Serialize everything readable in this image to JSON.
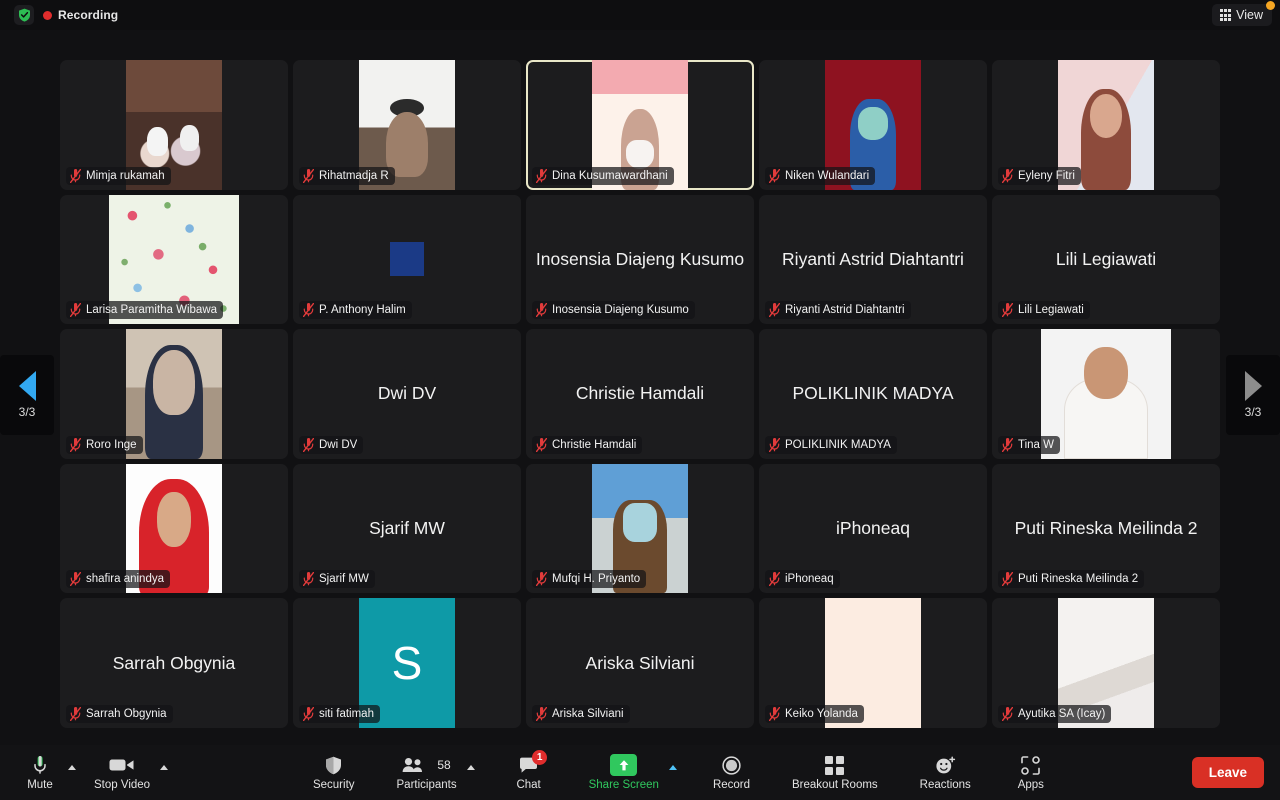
{
  "topbar": {
    "shield_icon": "shield-check-icon",
    "recording_label": "Recording",
    "view_label": "View",
    "view_icon": "grid-icon"
  },
  "gallery": {
    "page_indicator": "3/3",
    "prev_label": "3/3",
    "next_label": "3/3",
    "active_accent": "#e9e7c8",
    "participants": [
      {
        "name": "Mimja rukamah",
        "display": "",
        "muted": true,
        "video": "room",
        "active": false
      },
      {
        "name": "Rihatmadja R",
        "display": "",
        "muted": true,
        "video": "whiteboard",
        "active": false
      },
      {
        "name": "Dina Kusumawardhani",
        "display": "",
        "muted": true,
        "video": "pink-banner",
        "active": true
      },
      {
        "name": "Niken Wulandari",
        "display": "",
        "muted": true,
        "video": "red-banner",
        "active": false
      },
      {
        "name": "Eyleny Fitri",
        "display": "",
        "muted": true,
        "video": "pink-backdrop",
        "active": false
      },
      {
        "name": "Larisa Paramitha Wibawa",
        "display": "",
        "muted": true,
        "video": "floral",
        "active": false
      },
      {
        "name": "P. Anthony Halim",
        "display": "",
        "muted": true,
        "video": "blue-square",
        "active": false
      },
      {
        "name": "Inosensia Diajeng Kusumo",
        "display": "Inosensia Diajeng Kusumo",
        "muted": true,
        "video": "none",
        "active": false
      },
      {
        "name": "Riyanti Astrid Diahtantri",
        "display": "Riyanti Astrid Diahtantri",
        "muted": true,
        "video": "none",
        "active": false
      },
      {
        "name": "Lili Legiawati",
        "display": "Lili Legiawati",
        "muted": true,
        "video": "none",
        "active": false
      },
      {
        "name": "Roro Inge",
        "display": "",
        "muted": true,
        "video": "hijab-room",
        "active": false
      },
      {
        "name": "Dwi DV",
        "display": "Dwi DV",
        "muted": true,
        "video": "none",
        "active": false
      },
      {
        "name": "Christie Hamdali",
        "display": "Christie Hamdali",
        "muted": true,
        "video": "none",
        "active": false
      },
      {
        "name": "POLIKLINIK MADYA",
        "display": "POLIKLINIK MADYA",
        "muted": true,
        "video": "none",
        "active": false
      },
      {
        "name": "Tina W",
        "display": "",
        "muted": true,
        "video": "portrait-white",
        "active": false
      },
      {
        "name": "shafira anindya",
        "display": "",
        "muted": true,
        "video": "red-hijab",
        "active": false
      },
      {
        "name": "Sjarif MW",
        "display": "Sjarif MW",
        "muted": true,
        "video": "none",
        "active": false
      },
      {
        "name": "Mufqi H. Priyanto",
        "display": "",
        "muted": true,
        "video": "building",
        "active": false
      },
      {
        "name": "iPhoneaq",
        "display": "iPhoneaq",
        "muted": true,
        "video": "none",
        "active": false
      },
      {
        "name": "Puti Rineska Meilinda 2",
        "display": "Puti Rineska Meilinda 2",
        "muted": true,
        "video": "none",
        "active": false
      },
      {
        "name": "Sarrah Obgynia",
        "display": "Sarrah Obgynia",
        "muted": true,
        "video": "none",
        "active": false
      },
      {
        "name": "siti fatimah",
        "display": "",
        "muted": true,
        "video": "avatar",
        "avatar_letter": "S",
        "avatar_color": "#0e9aa7",
        "active": false
      },
      {
        "name": "Ariska Silviani",
        "display": "Ariska Silviani",
        "muted": true,
        "video": "none",
        "active": false
      },
      {
        "name": "Keiko Yolanda",
        "display": "",
        "muted": true,
        "video": "cream",
        "active": false
      },
      {
        "name": "Ayutika SA (Icay)",
        "display": "",
        "muted": true,
        "video": "blur-white",
        "active": false
      }
    ]
  },
  "toolbar": {
    "mute_label": "Mute",
    "stop_video_label": "Stop Video",
    "security_label": "Security",
    "participants_label": "Participants",
    "participants_count": "58",
    "chat_label": "Chat",
    "chat_badge": "1",
    "share_screen_label": "Share Screen",
    "share_screen_color": "#30c85e",
    "record_label": "Record",
    "breakout_label": "Breakout Rooms",
    "reactions_label": "Reactions",
    "apps_label": "Apps",
    "leave_label": "Leave",
    "leave_color": "#d93025"
  }
}
